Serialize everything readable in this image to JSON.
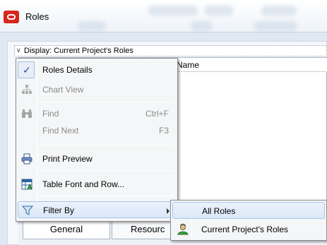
{
  "window": {
    "title": "Roles",
    "accent_color": "#d8261c"
  },
  "panel": {
    "display_label": "Display: Current Project's Roles",
    "name_column_header": "Name"
  },
  "tabs": [
    {
      "label": "General"
    },
    {
      "label": "Resourc"
    }
  ],
  "context_menu": {
    "items": [
      {
        "label": "Roles Details",
        "icon": "checkmark-icon",
        "checked": true,
        "enabled": true
      },
      {
        "label": "Chart View",
        "icon": "org-chart-icon",
        "enabled": false
      },
      {
        "label": "Find",
        "shortcut": "Ctrl+F",
        "icon": "binoculars-icon",
        "enabled": false
      },
      {
        "label": "Find Next",
        "shortcut": "F3",
        "enabled": false
      },
      {
        "label": "Print Preview",
        "icon": "printer-icon",
        "enabled": true
      },
      {
        "label": "Table Font and Row...",
        "icon": "table-font-icon",
        "enabled": true
      },
      {
        "label": "Filter By",
        "icon": "funnel-icon",
        "enabled": true,
        "has_submenu": true
      }
    ]
  },
  "filter_submenu": {
    "items": [
      {
        "label": "All Roles",
        "highlighted": true
      },
      {
        "label": "Current Project's Roles",
        "icon": "role-person-icon"
      }
    ]
  }
}
